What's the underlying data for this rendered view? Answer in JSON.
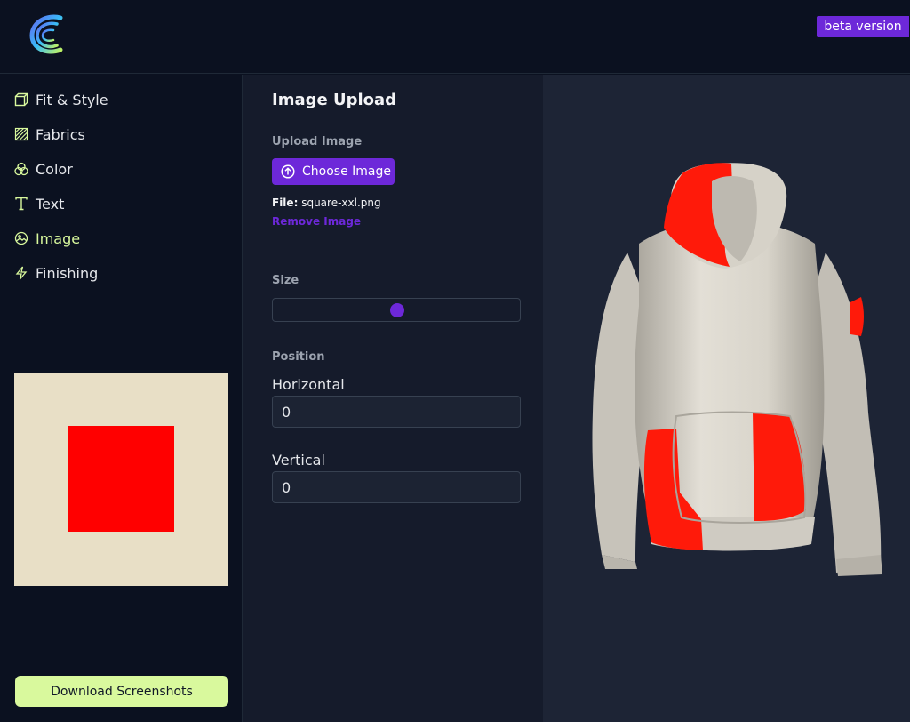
{
  "header": {
    "logo": "brand-logo",
    "beta_label": "beta version",
    "accent": "#6d28d9"
  },
  "sidebar": {
    "items": [
      {
        "label": "Fit & Style",
        "icon": "cube-icon"
      },
      {
        "label": "Fabrics",
        "icon": "fabric-texture-icon"
      },
      {
        "label": "Color",
        "icon": "color-circles-icon"
      },
      {
        "label": "Text",
        "icon": "text-icon"
      },
      {
        "label": "Image",
        "icon": "image-icon",
        "active": true
      },
      {
        "label": "Finishing",
        "icon": "lightning-icon"
      }
    ],
    "active_color": "#d9f99d",
    "preview": {
      "background": "#e8dfc6",
      "square_color": "#ff0000"
    },
    "download_label": "Download Screenshots"
  },
  "panel": {
    "title": "Image Upload",
    "upload_label": "Upload Image",
    "choose_label": "Choose Image",
    "file_prefix": "File:",
    "file_name": "square-xxl.png",
    "remove_label": "Remove Image",
    "size_label": "Size",
    "size_value": 0.5,
    "position_label": "Position",
    "horizontal_label": "Horizontal",
    "horizontal_value": "0",
    "vertical_label": "Vertical",
    "vertical_value": "0"
  },
  "viewport": {
    "garment": "hoodie",
    "body_color": "#dcd8cf",
    "print_color": "#ff1a0a"
  }
}
